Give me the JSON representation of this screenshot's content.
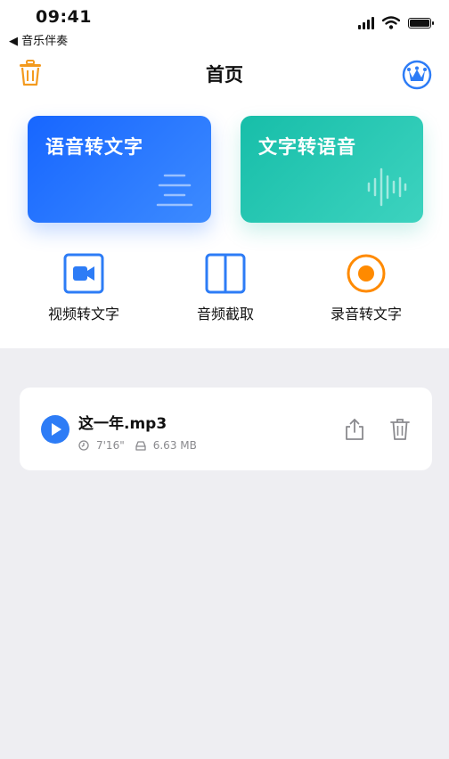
{
  "status_bar": {
    "time": "09:41",
    "back_app": "◀ 音乐伴奏"
  },
  "header": {
    "title": "首页"
  },
  "cards": [
    {
      "label": "语音转文字",
      "color": "#1766FF"
    },
    {
      "label": "文字转语音",
      "color": "#17BEA9"
    }
  ],
  "tools": [
    {
      "label": "视频转文字",
      "icon": "video-icon",
      "color": "#2D7CF6"
    },
    {
      "label": "音频截取",
      "icon": "split-icon",
      "color": "#2D7CF6"
    },
    {
      "label": "录音转文字",
      "icon": "record-icon",
      "color": "#FF8A00"
    }
  ],
  "files": [
    {
      "name": "这一年.mp3",
      "duration": "7'16\"",
      "size": "6.63 MB"
    }
  ],
  "colors": {
    "accent_blue": "#2D7CF6",
    "accent_orange": "#F39A1E",
    "background": "#EEEEF2"
  }
}
